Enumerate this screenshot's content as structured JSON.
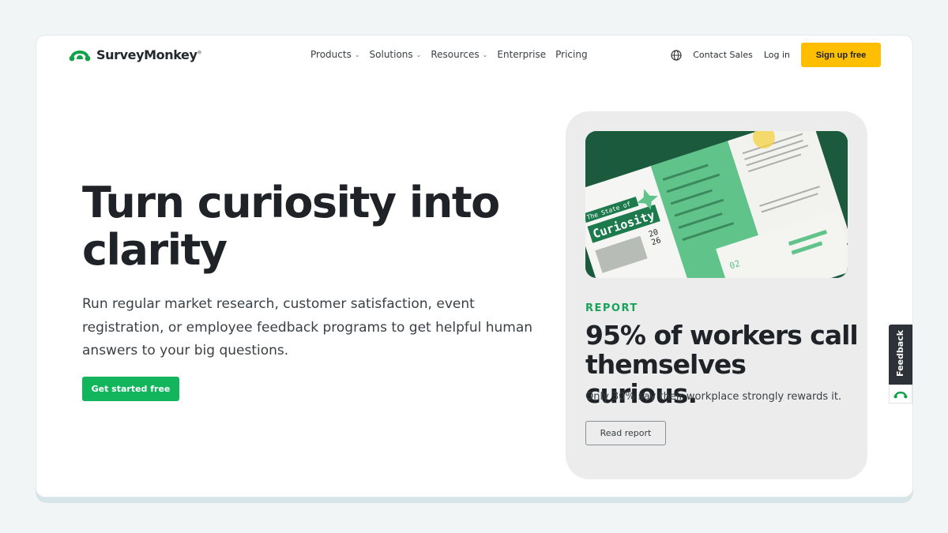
{
  "header": {
    "brand": "SurveyMonkey",
    "brand_mark": "®",
    "nav": [
      {
        "label": "Products",
        "dropdown": true
      },
      {
        "label": "Solutions",
        "dropdown": true
      },
      {
        "label": "Resources",
        "dropdown": true
      },
      {
        "label": "Enterprise",
        "dropdown": false
      },
      {
        "label": "Pricing",
        "dropdown": false
      }
    ],
    "contact_sales": "Contact Sales",
    "login": "Log in",
    "signup": "Sign up free"
  },
  "hero": {
    "headline": "Turn curiosity into clarity",
    "subtext": "Run regular market research, customer satisfaction, event registration, or employee feedback programs to get helpful human answers to your big questions.",
    "cta": "Get started free"
  },
  "report_card": {
    "label": "REPORT",
    "title": "95% of workers call themselves curious.",
    "subtitle": "Only 30% say their workplace strongly rewards it.",
    "button": "Read report",
    "image": {
      "cover_prefix": "The State of",
      "cover_title": "Curiosity",
      "cover_year": "20\n26",
      "page_number": "02"
    }
  },
  "feedback": {
    "label": "Feedback"
  },
  "colors": {
    "accent_green": "#12b55c",
    "signup_yellow": "#ffbf00",
    "dark_green": "#1c5a3d"
  }
}
